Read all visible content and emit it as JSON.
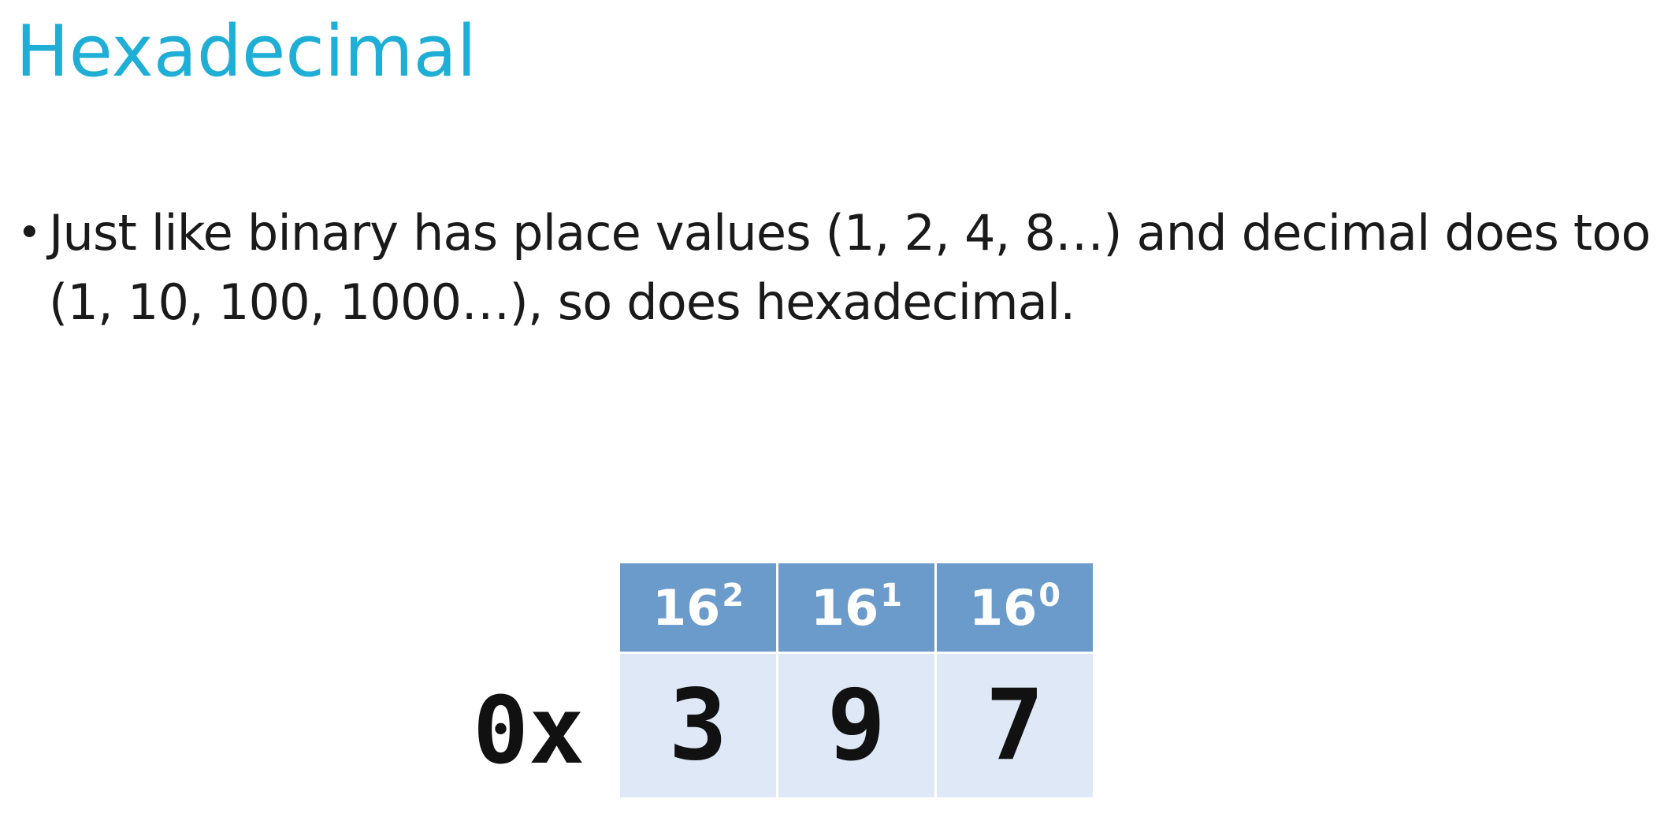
{
  "slide": {
    "title": "Hexadecimal",
    "bullets": [
      "Just like binary has place values (1, 2, 4, 8…) and decimal does too (1, 10, 100, 1000…), so does hexadecimal."
    ]
  },
  "example": {
    "prefix": "0x",
    "places": [
      {
        "base": "16",
        "exponent": "2",
        "digit": "3"
      },
      {
        "base": "16",
        "exponent": "1",
        "digit": "9"
      },
      {
        "base": "16",
        "exponent": "0",
        "digit": "7"
      }
    ]
  },
  "colors": {
    "title": "#1eaed6",
    "header_bg": "#6a9bcb",
    "digit_bg": "#dee8f6"
  }
}
